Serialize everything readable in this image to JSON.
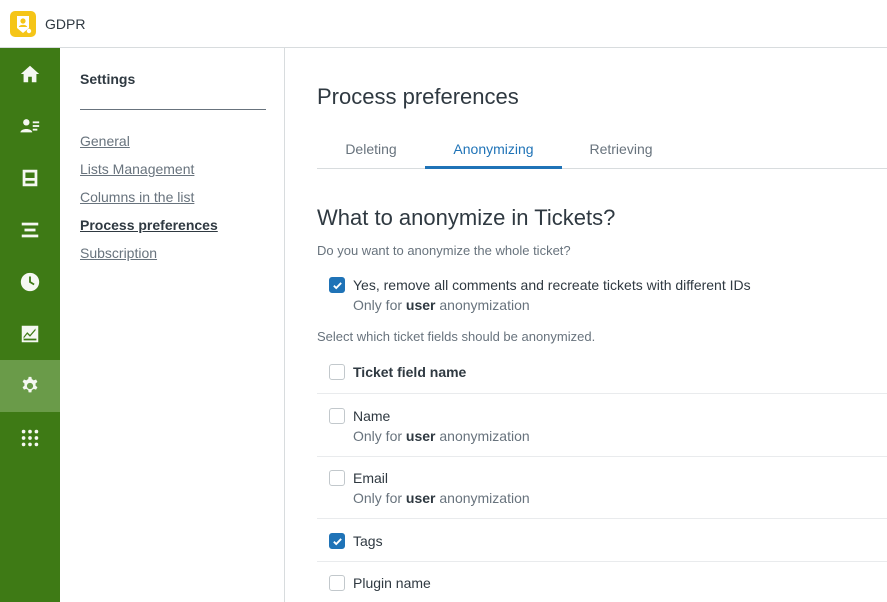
{
  "app": {
    "name": "GDPR",
    "logo_color": "#f5c518"
  },
  "nav": {
    "bg_color": "#3e7a15",
    "active_color": "#6a9b49",
    "items": [
      {
        "icon": "home-icon"
      },
      {
        "icon": "contacts-icon"
      },
      {
        "icon": "archive-icon"
      },
      {
        "icon": "stack-icon"
      },
      {
        "icon": "clock-icon"
      },
      {
        "icon": "chart-icon"
      },
      {
        "icon": "gear-icon",
        "active": true
      },
      {
        "icon": "apps-grid-icon"
      }
    ]
  },
  "subnav": {
    "title": "Settings",
    "links": [
      {
        "label": "General"
      },
      {
        "label": "Lists Management"
      },
      {
        "label": "Columns in the list"
      },
      {
        "label": "Process preferences",
        "current": true
      },
      {
        "label": "Subscription"
      }
    ]
  },
  "main": {
    "title": "Process preferences",
    "tabs": [
      {
        "label": "Deleting"
      },
      {
        "label": "Anonymizing",
        "active": true
      },
      {
        "label": "Retrieving"
      }
    ],
    "accent_color": "#1f73b7",
    "section_title": "What to anonymize in Tickets?",
    "whole_question": "Do you want to anonymize the whole ticket?",
    "whole_option": {
      "label": "Yes, remove all comments and recreate tickets with different IDs",
      "checked": true,
      "sub_prefix": "Only for",
      "sub_strong": "user",
      "sub_suffix": "anonymization"
    },
    "fields_hint": "Select which ticket fields should be anonymized.",
    "fields_header": {
      "label": "Ticket field name",
      "checked": false
    },
    "fields": [
      {
        "label": "Name",
        "checked": false,
        "sub_prefix": "Only for",
        "sub_strong": "user",
        "sub_suffix": "anonymization"
      },
      {
        "label": "Email",
        "checked": false,
        "sub_prefix": "Only for",
        "sub_strong": "user",
        "sub_suffix": "anonymization"
      },
      {
        "label": "Tags",
        "checked": true
      },
      {
        "label": "Plugin name",
        "checked": false
      }
    ]
  }
}
